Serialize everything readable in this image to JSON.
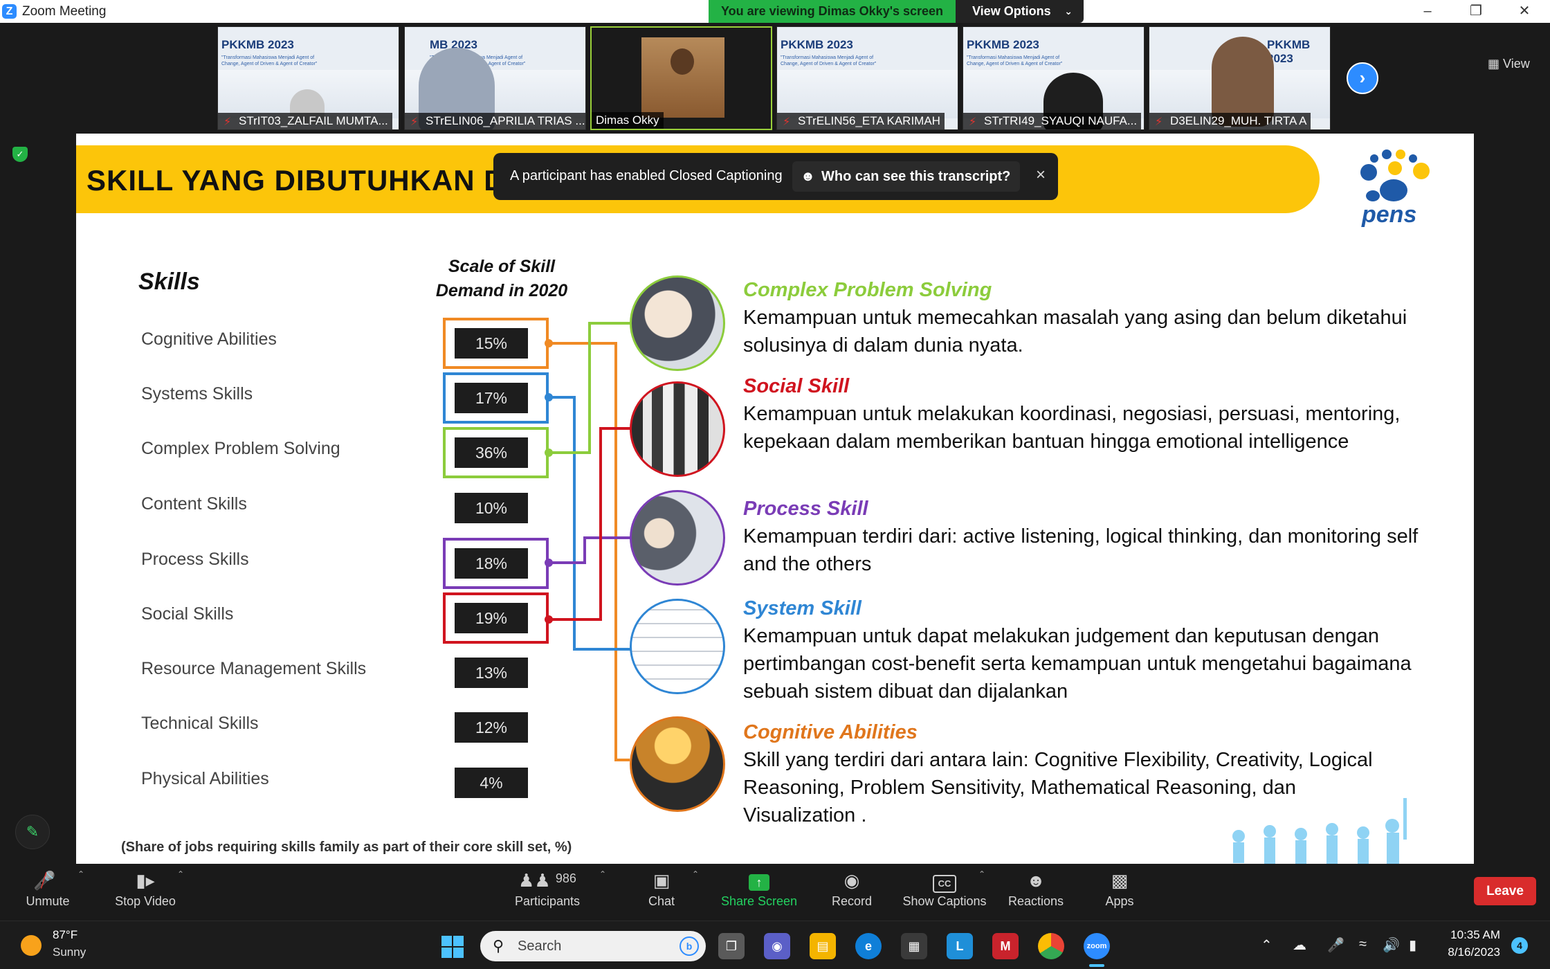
{
  "window": {
    "title": "Zoom Meeting",
    "viewing_banner": "You are viewing Dimas Okky's screen",
    "view_options": "View Options",
    "view_button": "View"
  },
  "participants_strip": [
    {
      "name": "STrIT03_ZALFAIL MUMTA...",
      "muted": true,
      "thumb_title": "PKKMB 2023"
    },
    {
      "name": "STrELIN06_APRILIA TRIAS ...",
      "muted": true,
      "thumb_title": "MB 2023"
    },
    {
      "name": "Dimas Okky",
      "muted": false,
      "active": true
    },
    {
      "name": "STrELIN56_ETA KARIMAH",
      "muted": true,
      "thumb_title": "PKKMB 2023"
    },
    {
      "name": "STrTRI49_SYAUQI NAUFA...",
      "muted": true,
      "thumb_title": "PKKMB 2023"
    },
    {
      "name": "D3ELIN29_MUH. TIRTA A",
      "muted": true,
      "thumb_title": "PKKMB 2023"
    }
  ],
  "thumb_subtitle": "\"Transformasi Mahasiswa Menjadi Agent of Change, Agent of Driven & Agent of Creator\"",
  "caption_toast": {
    "message": "A participant has enabled Closed Captioning",
    "who_button": "Who can see this transcript?",
    "close": "×"
  },
  "slide": {
    "title": "SKILL YANG DIBUTUHKAN DI INDUSTRI 4.0",
    "logo_text": "pens",
    "skills_heading": "Skills",
    "scale_heading_line1": "Scale of Skill",
    "scale_heading_line2": "Demand in 2020",
    "skills": [
      {
        "label": "Cognitive Abilities",
        "pct": "15%",
        "frame": "#f08a24"
      },
      {
        "label": "Systems Skills",
        "pct": "17%",
        "frame": "#2f86d4"
      },
      {
        "label": "Complex Problem Solving",
        "pct": "36%",
        "frame": "#8ccc3c"
      },
      {
        "label": "Content Skills",
        "pct": "10%",
        "frame": ""
      },
      {
        "label": "Process Skills",
        "pct": "18%",
        "frame": "#7a3cb6"
      },
      {
        "label": "Social Skills",
        "pct": "19%",
        "frame": "#d0141f"
      },
      {
        "label": "Resource Management Skills",
        "pct": "13%",
        "frame": ""
      },
      {
        "label": "Technical Skills",
        "pct": "12%",
        "frame": ""
      },
      {
        "label": "Physical Abilities",
        "pct": "4%",
        "frame": ""
      }
    ],
    "descriptions": [
      {
        "head": "Complex Problem Solving",
        "color": "#8ccc3c",
        "body": "Kemampuan untuk memecahkan masalah yang asing dan belum diketahui solusinya di dalam dunia nyata."
      },
      {
        "head": "Social Skill",
        "color": "#d0141f",
        "body": "Kemampuan untuk melakukan koordinasi, negosiasi, persuasi, mentoring, kepekaan dalam memberikan bantuan hingga emotional intelligence"
      },
      {
        "head": "Process Skill",
        "color": "#7a3cb6",
        "body": "Kemampuan terdiri dari: active listening, logical thinking, dan monitoring self and the others"
      },
      {
        "head": "System Skill",
        "color": "#2f86d4",
        "body": "Kemampuan untuk dapat melakukan judgement dan keputusan dengan pertimbangan cost-benefit serta kemampuan untuk mengetahui bagaimana sebuah sistem dibuat dan dijalankan"
      },
      {
        "head": "Cognitive Abilities",
        "color": "#e0761c",
        "body": "Skill yang terdiri dari antara lain: Cognitive Flexibility, Creativity, Logical Reasoning, Problem Sensitivity, Mathematical Reasoning, dan Visualization ."
      }
    ],
    "footnote": "(Share of jobs requiring skills family as part of their core skill set, %)"
  },
  "toolbar": {
    "unmute": "Unmute",
    "stop_video": "Stop Video",
    "participants": "Participants",
    "participants_count": "986",
    "chat": "Chat",
    "share_screen": "Share Screen",
    "record": "Record",
    "show_captions": "Show Captions",
    "reactions": "Reactions",
    "apps": "Apps",
    "leave": "Leave"
  },
  "taskbar": {
    "temperature": "87°F",
    "condition": "Sunny",
    "search_placeholder": "Search",
    "time": "10:35 AM",
    "date": "8/16/2023",
    "notifications": "4"
  }
}
